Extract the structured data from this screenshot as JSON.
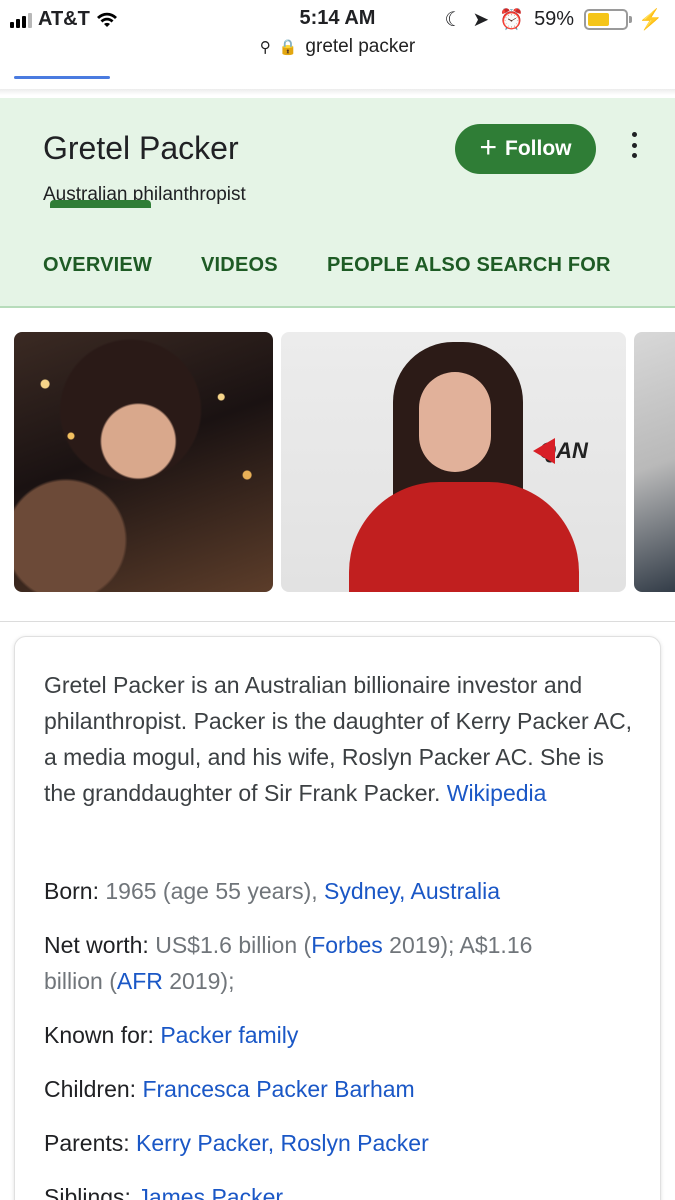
{
  "status_bar": {
    "carrier": "AT&T",
    "time": "5:14 AM",
    "battery": "59%",
    "battery_level": 0.59
  },
  "url_bar": {
    "query": "gretel packer"
  },
  "knowledge_panel": {
    "title": "Gretel Packer",
    "subtitle": "Australian philanthropist",
    "follow_label": "Follow",
    "tabs": [
      {
        "label": "OVERVIEW",
        "active": true
      },
      {
        "label": "VIDEOS",
        "active": false
      },
      {
        "label": "PEOPLE ALSO SEARCH FOR",
        "active": false
      }
    ],
    "accent_color": "#2f7d36",
    "header_bg": "#e5f4e6"
  },
  "images": [
    {
      "icon": "portrait-photo"
    },
    {
      "icon": "portrait-photo",
      "logo_text": "QAN"
    },
    {
      "icon": "portrait-photo"
    }
  ],
  "description": {
    "text": "Gretel Packer is an Australian billionaire investor and philanthropist. Packer is the daughter of Kerry Packer AC, a media mogul, and his wife, Roslyn Packer AC. She is the granddaughter of Sir Frank Packer.",
    "source_link": "Wikipedia"
  },
  "facts": {
    "born": {
      "label": "Born:",
      "value": "1965 (age 55 years),",
      "place1": "Sydney,",
      "place2": "Australia"
    },
    "net_worth": {
      "label": "Net worth:",
      "part1": "US$1.6 billion (",
      "link1": "Forbes",
      "part2": " 2019); A$1.16",
      "part3": "billion (",
      "link2": "AFR",
      "part4": " 2019);"
    },
    "known_for": {
      "label": "Known for:",
      "value": "Packer family"
    },
    "children": {
      "label": "Children:",
      "value": "Francesca Packer Barham"
    },
    "parents": {
      "label": "Parents:",
      "value1": "Kerry Packer,",
      "value2": "Roslyn Packer"
    },
    "siblings": {
      "label": "Siblings:",
      "value": "James Packer"
    }
  }
}
